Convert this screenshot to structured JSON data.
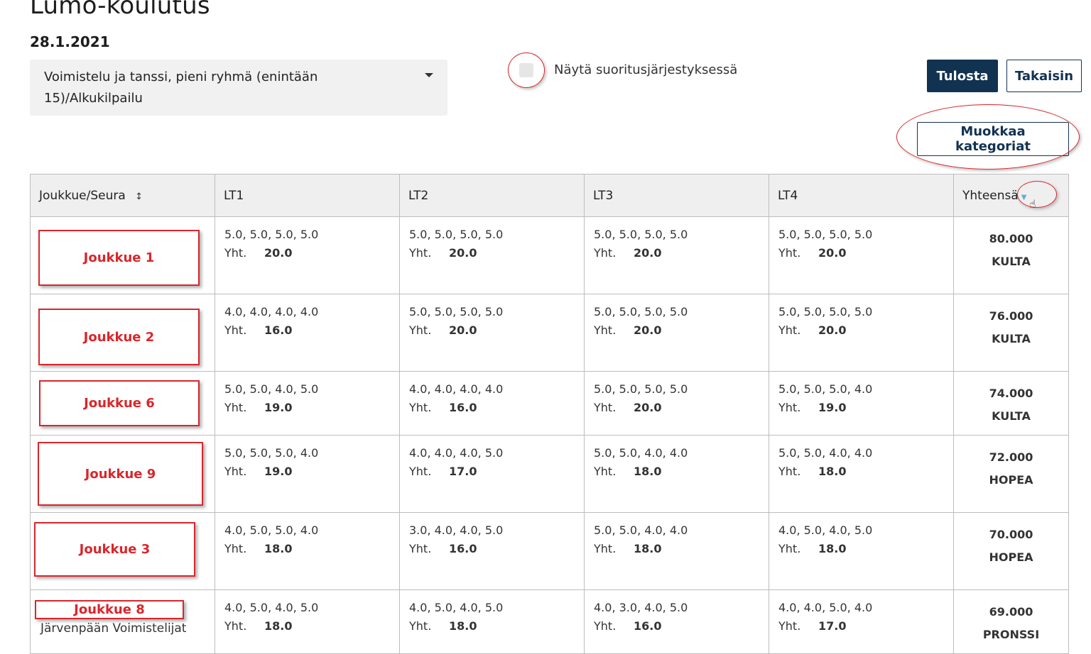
{
  "header": {
    "title": "Lumo-koulutus",
    "date": "28.1.2021"
  },
  "category_select": {
    "value": "Voimistelu ja tanssi, pieni ryhmä (enintään 15)/Alkukilpailu"
  },
  "order_toggle": {
    "label": "Näytä suoritusjärjestyksessä",
    "checked": false
  },
  "buttons": {
    "print": "Tulosta",
    "back": "Takaisin",
    "edit_categories": "Muokkaa kategoriat"
  },
  "table": {
    "headers": [
      "Joukkue/Seura",
      "LT1",
      "LT2",
      "LT3",
      "LT4",
      "Yhteensä"
    ],
    "sum_label": "Yht.",
    "rows": [
      {
        "team": "Joukkue 1",
        "club": "",
        "cols": [
          {
            "scores": "5.0, 5.0, 5.0, 5.0",
            "sum": "20.0"
          },
          {
            "scores": "5.0, 5.0, 5.0, 5.0",
            "sum": "20.0"
          },
          {
            "scores": "5.0, 5.0, 5.0, 5.0",
            "sum": "20.0"
          },
          {
            "scores": "5.0, 5.0, 5.0, 5.0",
            "sum": "20.0"
          }
        ],
        "total": "80.000",
        "medal": "KULTA"
      },
      {
        "team": "Joukkue 2",
        "club": "",
        "cols": [
          {
            "scores": "4.0, 4.0, 4.0, 4.0",
            "sum": "16.0"
          },
          {
            "scores": "5.0, 5.0, 5.0, 5.0",
            "sum": "20.0"
          },
          {
            "scores": "5.0, 5.0, 5.0, 5.0",
            "sum": "20.0"
          },
          {
            "scores": "5.0, 5.0, 5.0, 5.0",
            "sum": "20.0"
          }
        ],
        "total": "76.000",
        "medal": "KULTA"
      },
      {
        "team": "Joukkue 6",
        "club": "",
        "cols": [
          {
            "scores": "5.0, 5.0, 4.0, 5.0",
            "sum": "19.0"
          },
          {
            "scores": "4.0, 4.0, 4.0, 4.0",
            "sum": "16.0"
          },
          {
            "scores": "5.0, 5.0, 5.0, 5.0",
            "sum": "20.0"
          },
          {
            "scores": "5.0, 5.0, 5.0, 4.0",
            "sum": "19.0"
          }
        ],
        "total": "74.000",
        "medal": "KULTA"
      },
      {
        "team": "Joukkue 9",
        "club": "",
        "cols": [
          {
            "scores": "5.0, 5.0, 5.0, 4.0",
            "sum": "19.0"
          },
          {
            "scores": "4.0, 4.0, 4.0, 5.0",
            "sum": "17.0"
          },
          {
            "scores": "5.0, 5.0, 4.0, 4.0",
            "sum": "18.0"
          },
          {
            "scores": "5.0, 5.0, 4.0, 4.0",
            "sum": "18.0"
          }
        ],
        "total": "72.000",
        "medal": "HOPEA"
      },
      {
        "team": "Joukkue 3",
        "club": "",
        "cols": [
          {
            "scores": "4.0, 5.0, 5.0, 4.0",
            "sum": "18.0"
          },
          {
            "scores": "3.0, 4.0, 4.0, 5.0",
            "sum": "16.0"
          },
          {
            "scores": "5.0, 5.0, 4.0, 4.0",
            "sum": "18.0"
          },
          {
            "scores": "4.0, 5.0, 4.0, 5.0",
            "sum": "18.0"
          }
        ],
        "total": "70.000",
        "medal": "HOPEA"
      },
      {
        "team": "Joukkue 8",
        "club": "Järvenpään Voimistelijat",
        "cols": [
          {
            "scores": "4.0, 5.0, 4.0, 5.0",
            "sum": "18.0"
          },
          {
            "scores": "4.0, 5.0, 4.0, 5.0",
            "sum": "18.0"
          },
          {
            "scores": "4.0, 3.0, 4.0, 5.0",
            "sum": "16.0"
          },
          {
            "scores": "4.0, 4.0, 5.0, 4.0",
            "sum": "17.0"
          }
        ],
        "total": "69.000",
        "medal": "PRONSSI"
      }
    ]
  },
  "icons": {
    "sort": "sort-updown-icon",
    "caret": "caret-down-icon",
    "cursor": "hand-cursor-icon"
  },
  "colors": {
    "primary": "#123251",
    "annotation_red": "#d9262b",
    "header_bg": "#efefef",
    "sorted_header": "#6aa9d2"
  }
}
